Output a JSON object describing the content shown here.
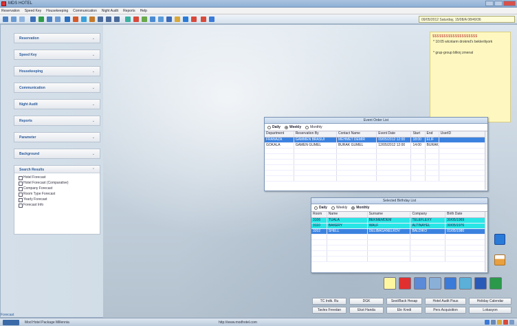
{
  "window": {
    "title": "MDS HOTEL"
  },
  "menu": [
    "Reservation",
    "Speed Key",
    "Housekeeping",
    "Communication",
    "Night Audit",
    "Reports",
    "Help"
  ],
  "toolbar": {
    "datetime": "09/05/2012 Saturday, 15/08/A 08/49/36"
  },
  "sidebar": {
    "items": [
      {
        "label": "Reservation"
      },
      {
        "label": "Speed Key"
      },
      {
        "label": "Housekeeping"
      },
      {
        "label": "Communication"
      },
      {
        "label": "Night Audit"
      },
      {
        "label": "Reports"
      },
      {
        "label": "Parameter"
      },
      {
        "label": "Background"
      }
    ],
    "search": {
      "header": "Search Results",
      "reports": [
        "Hotel Forecast",
        "Hotel Forecast (Comparative)",
        "Company Forecast",
        "Room Type Forecast",
        "Yearly Forecast",
        "Forecast Info"
      ]
    }
  },
  "sticky_note": {
    "pins": "$$$$$$$$$$$$$$$$$$$$",
    "lines": [
      "* 10:05 wlcnlarm drokmd'x bekleriliyork",
      "* grup-group bliknj zmenal"
    ]
  },
  "event_list": {
    "title": "Event Order List",
    "radios": [
      "Daily",
      "Weekly",
      "Monthly"
    ],
    "columns": [
      "Department",
      "Reservation By",
      "Contact Name",
      "Event Date",
      "Start",
      "End",
      "UserID"
    ],
    "rows": [
      [
        "FRANAZA",
        "GAMMEN BRASUI",
        "MEHMET DEMIR",
        "09/05/2012 12:00",
        "18:00",
        "ELIF",
        ""
      ],
      [
        "GOKALA",
        "GAMEN GUMEL",
        "BURAK GUMEL",
        "12/05/2012 12:00",
        "14:00",
        "BURAK",
        ""
      ]
    ]
  },
  "birthday_list": {
    "title": "Selected Birthday List",
    "radios": [
      "Daily",
      "Weekly",
      "Monthly"
    ],
    "columns": [
      "Room",
      "Name",
      "Surname",
      "Company",
      "Birth Date"
    ],
    "rows": [
      [
        "3106",
        "TUALA",
        "BEKMEMDEM",
        "TELEFLEXY",
        "30/05/1969"
      ],
      [
        "3110",
        "BAKERY",
        "WALF",
        "ALTINAYEL",
        "30/05/1976"
      ],
      [
        "3202",
        "SHELL",
        "DELIBAGANELKOV",
        "BALDIKO",
        "01/05/1980"
      ]
    ]
  },
  "bottom_buttons": {
    "row1": [
      "TC Indk. Ru",
      "DGK",
      "Sest/Back Hesap",
      "Hotel Audit Paus",
      "Holiday Calendar"
    ],
    "row2": [
      "Tavles Freedan",
      "Ekst Handa",
      "Ekr Kredi",
      "Pers Acquisition",
      "Lokasyon"
    ]
  },
  "status": {
    "left_label": "Forecast",
    "package": "Mod Hotel Package Millennia",
    "url": "http://www.modhotel.com"
  }
}
